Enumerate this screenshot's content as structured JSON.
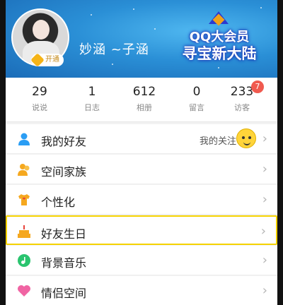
{
  "profile": {
    "nickname": "妙涵 ~子涵",
    "vip_badge": "开通"
  },
  "promo": {
    "line1": "QQ大会员",
    "line2": "寻宝新大陆"
  },
  "stats": [
    {
      "value": "29",
      "label": "说说"
    },
    {
      "value": "1",
      "label": "日志"
    },
    {
      "value": "612",
      "label": "相册"
    },
    {
      "value": "0",
      "label": "留言"
    },
    {
      "value": "233",
      "label": "访客"
    }
  ],
  "visitor_badge": "7",
  "menu": [
    {
      "label": "我的好友",
      "extra": "我的关注",
      "icon": "friend-icon",
      "color": "#2a9df4"
    },
    {
      "label": "空间家族",
      "icon": "family-icon",
      "color": "#f5a81f"
    },
    {
      "label": "个性化",
      "icon": "tshirt-icon",
      "color": "#f5a81f"
    },
    {
      "label": "好友生日",
      "icon": "cake-icon",
      "color": "#f5a81f",
      "highlighted": true
    },
    {
      "label": "背景音乐",
      "icon": "music-icon",
      "color": "#2ac46f"
    },
    {
      "label": "情侣空间",
      "icon": "heart-icon",
      "color": "#f064a3"
    }
  ],
  "chevron": "›"
}
